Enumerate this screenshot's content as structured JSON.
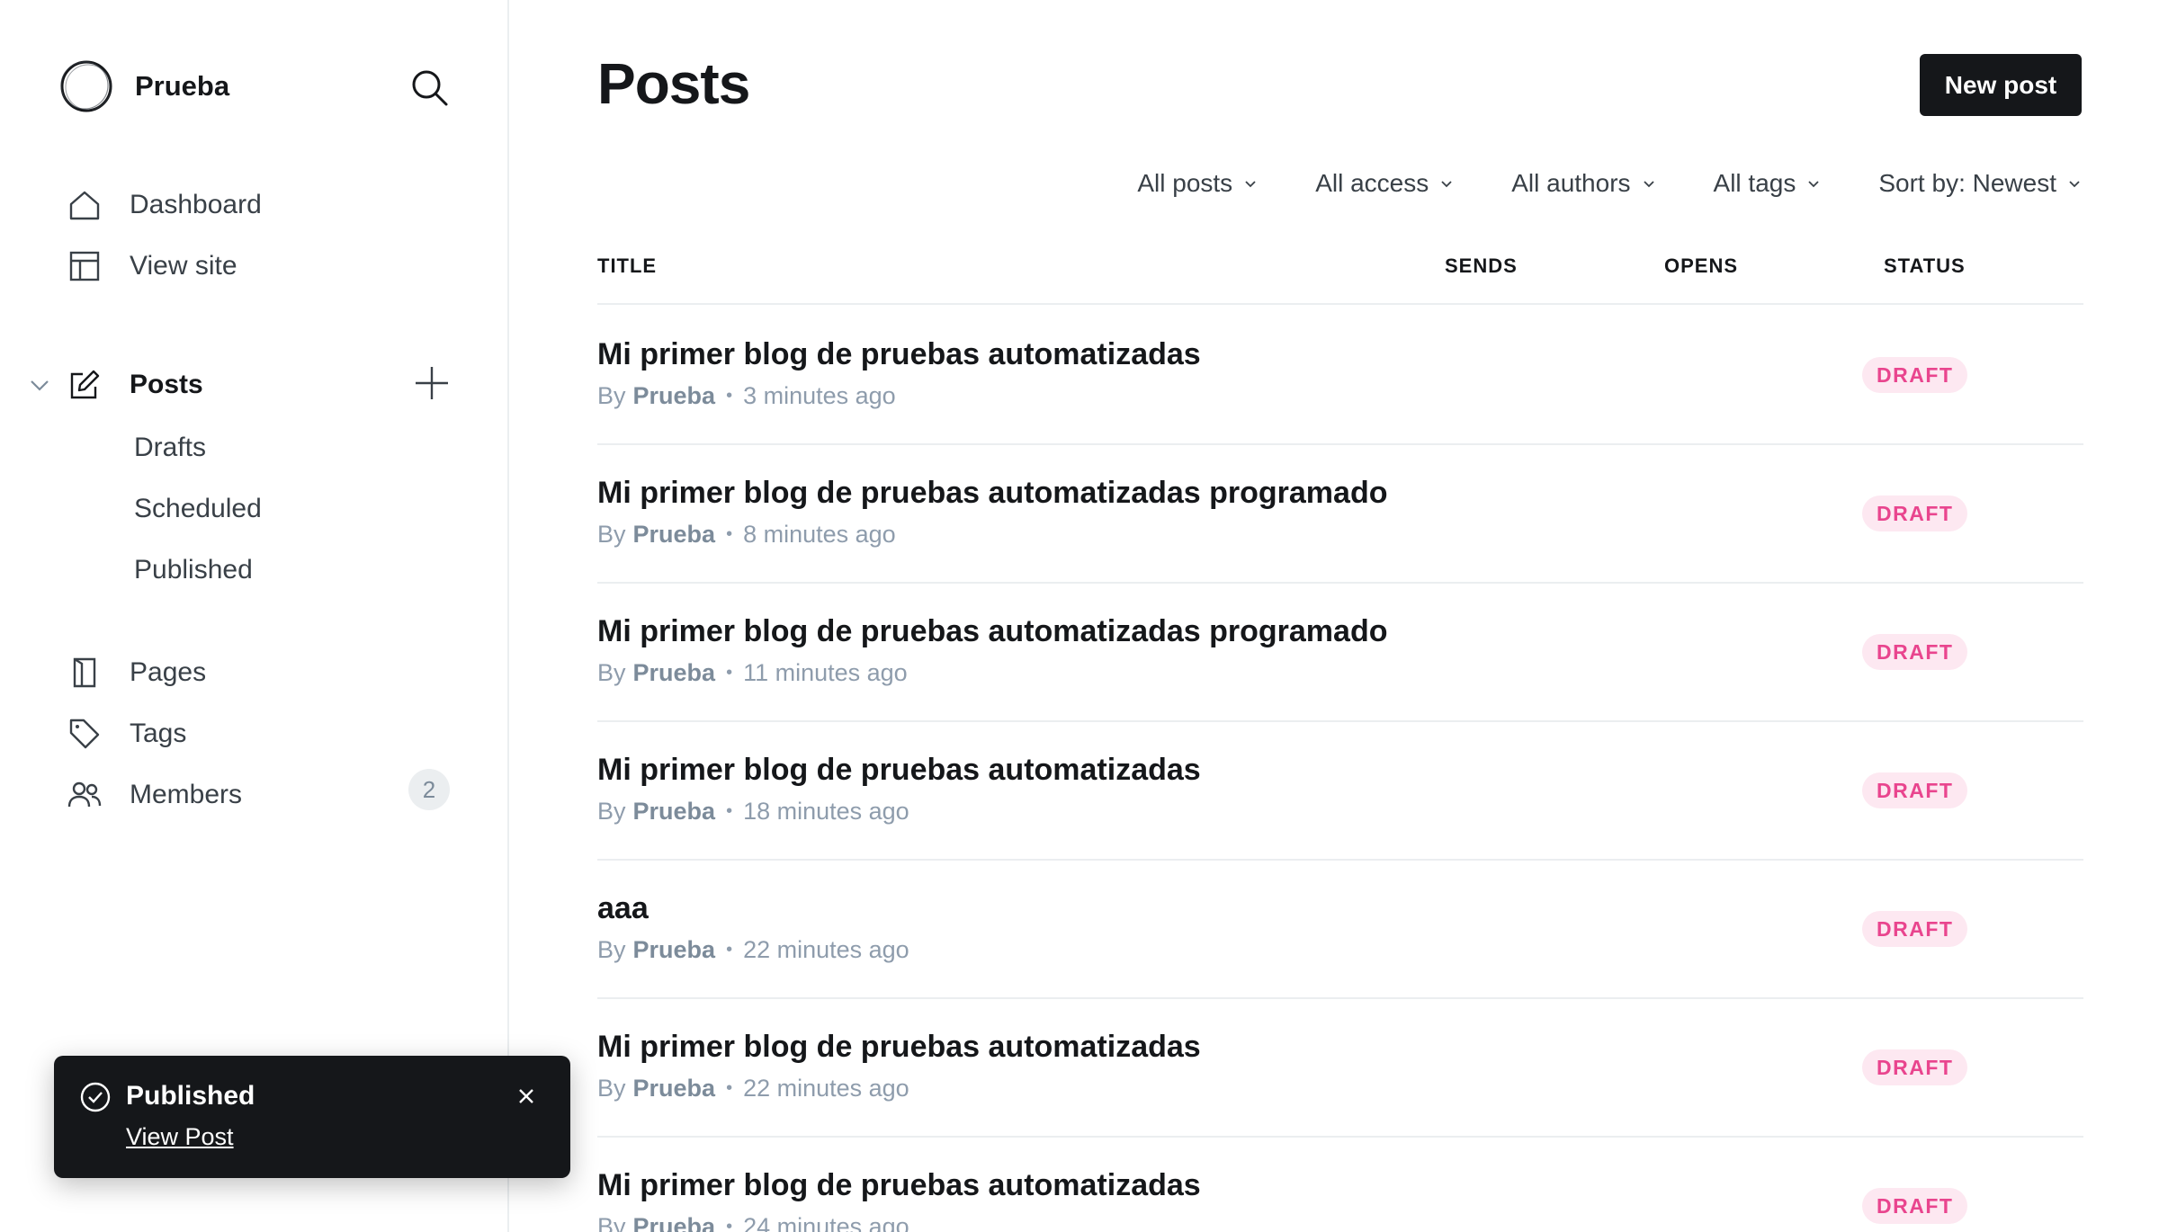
{
  "sidebar": {
    "site_name": "Prueba",
    "nav": {
      "dashboard": "Dashboard",
      "view_site": "View site",
      "posts": "Posts",
      "drafts": "Drafts",
      "scheduled": "Scheduled",
      "published": "Published",
      "pages": "Pages",
      "tags": "Tags",
      "members": "Members",
      "members_count": "2"
    },
    "icons": [
      "logo-icon",
      "search-icon",
      "home-icon",
      "layout-icon",
      "chevron-down-icon",
      "edit-icon",
      "plus-icon",
      "page-icon",
      "tag-icon",
      "members-icon"
    ]
  },
  "header": {
    "title": "Posts",
    "new_post_label": "New post"
  },
  "filters": {
    "type": "All posts",
    "access": "All access",
    "authors": "All authors",
    "tags": "All tags",
    "sort": "Sort by: Newest"
  },
  "table": {
    "columns": {
      "title": "TITLE",
      "sends": "SENDS",
      "opens": "OPENS",
      "status": "STATUS"
    },
    "rows": [
      {
        "title": "Mi primer blog de pruebas automatizadas",
        "by": "By",
        "author": "Prueba",
        "time": "3 minutes ago",
        "status": "DRAFT"
      },
      {
        "title": "Mi primer blog de pruebas automatizadas programado",
        "by": "By",
        "author": "Prueba",
        "time": "8 minutes ago",
        "status": "DRAFT"
      },
      {
        "title": "Mi primer blog de pruebas automatizadas programado",
        "by": "By",
        "author": "Prueba",
        "time": "11 minutes ago",
        "status": "DRAFT"
      },
      {
        "title": "Mi primer blog de pruebas automatizadas",
        "by": "By",
        "author": "Prueba",
        "time": "18 minutes ago",
        "status": "DRAFT"
      },
      {
        "title": "aaa",
        "by": "By",
        "author": "Prueba",
        "time": "22 minutes ago",
        "status": "DRAFT"
      },
      {
        "title": "Mi primer blog de pruebas automatizadas",
        "by": "By",
        "author": "Prueba",
        "time": "22 minutes ago",
        "status": "DRAFT"
      },
      {
        "title": "Mi primer blog de pruebas automatizadas",
        "by": "By",
        "author": "Prueba",
        "time": "24 minutes ago",
        "status": "DRAFT"
      }
    ]
  },
  "toast": {
    "title": "Published",
    "link": "View Post"
  },
  "colors": {
    "text": "#15171a",
    "muted": "#8e9cac",
    "draft_text": "#e9458e",
    "draft_bg": "#fde8f1",
    "button_bg": "#15171a"
  }
}
